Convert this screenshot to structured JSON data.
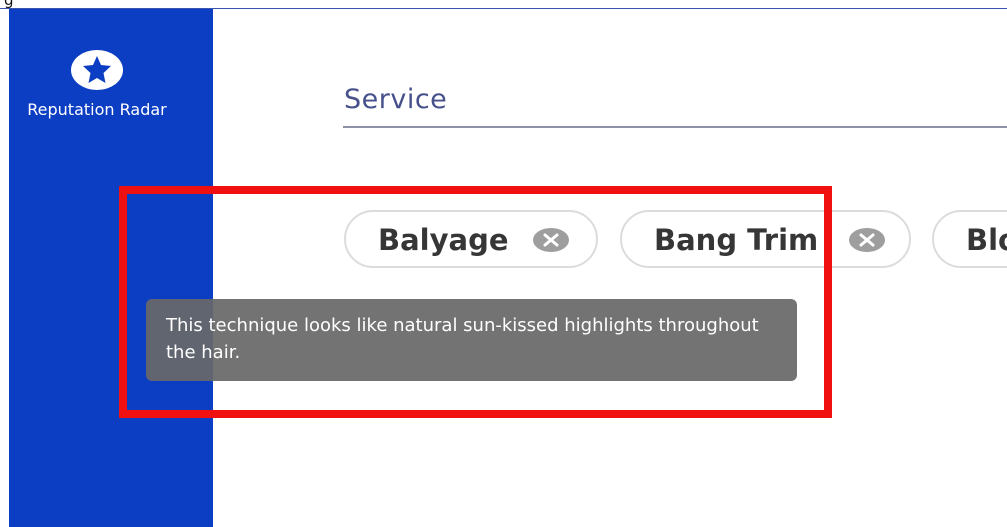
{
  "page": {
    "top_clipped_text": "g"
  },
  "sidebar": {
    "background": "#0c3ec4",
    "nav_item": {
      "icon": "star-badge-icon",
      "label": "Reputation Radar"
    }
  },
  "service_field": {
    "label": "Service"
  },
  "chips": [
    {
      "label": "Balyage",
      "remove_icon": "close-circle-icon"
    },
    {
      "label": "Bang Trim",
      "remove_icon": "close-circle-icon"
    },
    {
      "label": "Blo"
    }
  ],
  "tooltip": {
    "text": "This technique looks like natural sun-kissed highlights throughout the hair."
  },
  "colors": {
    "accent": "#0c3ec4",
    "highlight": "#f01010",
    "tooltip": "#686868"
  }
}
